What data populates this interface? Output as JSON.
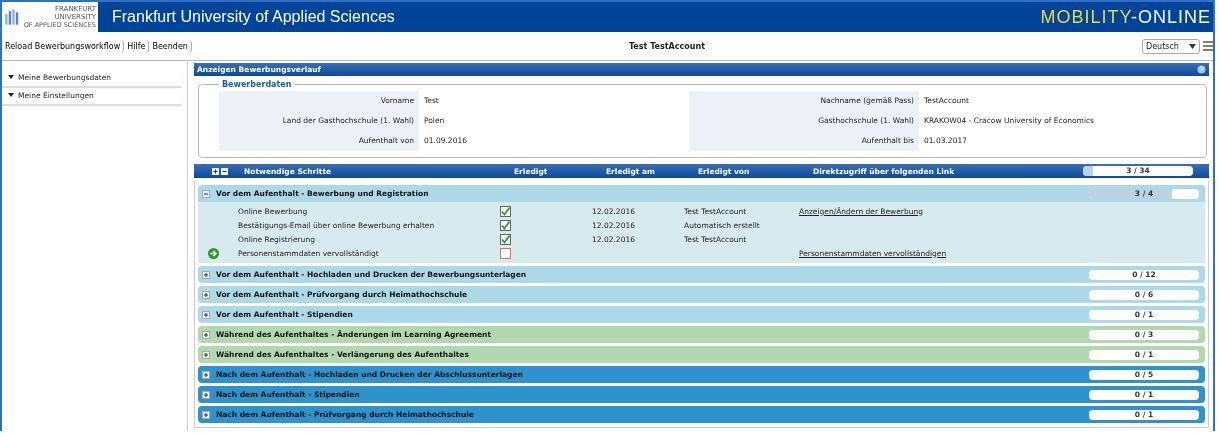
{
  "header": {
    "logo_lines": [
      "FRANKFURT",
      "UNIVERSITY",
      "OF APPLIED SCIENCES"
    ],
    "title": "Frankfurt University of Applied Sciences",
    "brand_a": "MOBILITY",
    "brand_b": "-ONLINE"
  },
  "toolbar": {
    "buttons": [
      "Reload Bewerbungsworkflow",
      "Hilfe",
      "Beenden"
    ],
    "user": "Test TestAccount",
    "language": "Deutsch"
  },
  "sidebar": {
    "items": [
      {
        "label": "Meine Bewerbungsdaten",
        "expanded": true
      },
      {
        "label": "Meine Einstellungen",
        "expanded": true
      }
    ]
  },
  "panel": {
    "title": "Anzeigen Bewerbungsverlauf"
  },
  "applicant": {
    "legend": "Bewerberdaten",
    "fields": [
      {
        "label": "Vorname",
        "value": "Test"
      },
      {
        "label": "Nachname (gemäß Pass)",
        "value": "TestAccount"
      },
      {
        "label": "Land der Gasthochschule (1. Wahl)",
        "value": "Polen"
      },
      {
        "label": "Gasthochschule (1. Wahl)",
        "value": "KRAKOW04 - Cracow University of Economics"
      },
      {
        "label": "Aufenthalt von",
        "value": "01.09.2016"
      },
      {
        "label": "Aufenthalt bis",
        "value": "01.03.2017"
      }
    ]
  },
  "steps_table": {
    "columns": [
      "Notwendige Schritte",
      "Erledigt",
      "Erledigt am",
      "Erledigt von",
      "Direktzugriff über folgenden Link"
    ],
    "total": "3 / 34",
    "level": 0.088,
    "sections": [
      {
        "title": "Vor dem Aufenthalt - Bewerbung und Registration",
        "color": "#add8e6",
        "expanded": true,
        "count": "3 / 4",
        "level": 0.75,
        "steps": [
          {
            "label": "Online Bewerbung",
            "done": true,
            "current": false,
            "date": "12.02.2016",
            "by": "Test TestAccount",
            "link": "Anzeigen/Ändern der Bewerbung"
          },
          {
            "label": "Bestätigungs-Email über online Bewerbung erhalten",
            "done": true,
            "current": false,
            "date": "12.02.2016",
            "by": "Automatisch erstellt"
          },
          {
            "label": "Online Registrierung",
            "done": true,
            "current": false,
            "date": "12.02.2016",
            "by": "Test TestAccount"
          },
          {
            "label": "Personenstammdaten vervollständigt",
            "done": false,
            "current": true,
            "link": "Personenstammdaten vervollständigen"
          }
        ]
      },
      {
        "title": "Vor dem Aufenthalt - Hochladen und Drucken der Bewerbungsunterlagen",
        "color": "#add8e6",
        "expanded": false,
        "count": "0 / 12"
      },
      {
        "title": "Vor dem Aufenthalt - Prüfvorgang durch Heimathochschule",
        "color": "#add8e6",
        "expanded": false,
        "count": "0 / 6"
      },
      {
        "title": "Vor dem Aufenthalt - Stipendien",
        "color": "#add8e6",
        "expanded": false,
        "count": "0 / 1"
      },
      {
        "title": "Während des Aufenthaltes - Änderungen im Learning Agreement",
        "color": "#b2d8b0",
        "expanded": false,
        "count": "0 / 3"
      },
      {
        "title": "Während des Aufenthaltes - Verlängerung des Aufenthaltes",
        "color": "#b2d8b0",
        "expanded": false,
        "count": "0 / 1"
      },
      {
        "title": "Nach dem Aufenthalt - Hochladen und Drucken der Abschlussunterlagen",
        "color": "#2e93cc",
        "expanded": false,
        "count": "0 / 5"
      },
      {
        "title": "Nach dem Aufenthalt - Stipendien",
        "color": "#2e93cc",
        "expanded": false,
        "count": "0 / 1"
      },
      {
        "title": "Nach dem Aufenthalt - Prüfvorgang durch Heimathochschule",
        "color": "#2e93cc",
        "expanded": false,
        "count": "0 / 1"
      }
    ]
  }
}
